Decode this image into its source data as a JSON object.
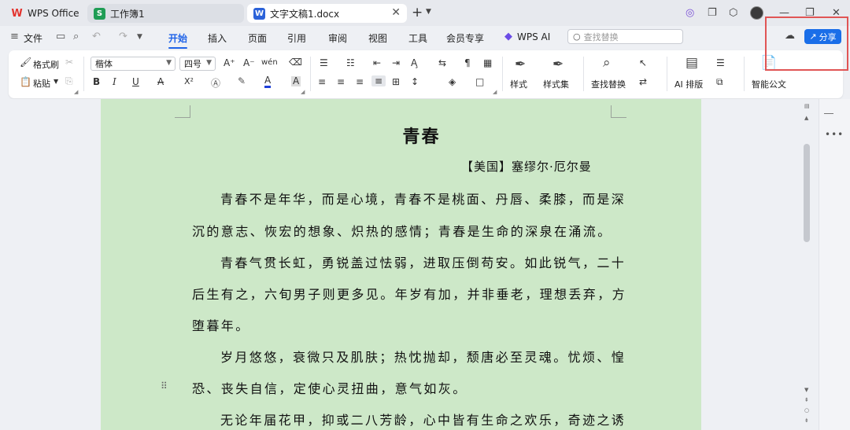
{
  "tabs": [
    {
      "label": "WPS Office",
      "logo": "W"
    },
    {
      "label": "工作簿1",
      "logo": "S"
    },
    {
      "label": "文字文稿1.docx",
      "logo": "W"
    }
  ],
  "menu": {
    "file": "文件",
    "items": [
      "开始",
      "插入",
      "页面",
      "引用",
      "审阅",
      "视图",
      "工具",
      "会员专享",
      "WPS AI"
    ],
    "active": "开始",
    "search_placeholder": "查找替换",
    "share": "分享"
  },
  "ribbon": {
    "format_painter": "格式刷",
    "paste": "粘贴",
    "font_name": "楷体",
    "font_size": "四号",
    "style": "样式",
    "style_set": "样式集",
    "find_replace": "查找替换",
    "ai_layout": "AI 排版",
    "smart_doc": "智能公文",
    "bold": "B",
    "italic": "I",
    "underline": "U",
    "strike": "A",
    "superscript": "X²",
    "font_color": "A",
    "char_shade": "A",
    "grow": "A⁺",
    "shrink": "A⁻",
    "phonetic": "wén",
    "clear_format": "⌫"
  },
  "colors": {
    "accent": "#1f63e8",
    "share_bg": "#1a6ee8",
    "page_bg": "#cde8c8",
    "highlight_box": "#e05555"
  },
  "document": {
    "title": "青春",
    "author": "【美国】塞缪尔·厄尔曼",
    "lines": [
      "青春不是年华，而是心境，青春不是桃面、丹唇、柔膝，而是深",
      "沉的意志、恢宏的想象、炽热的感情；青春是生命的深泉在涌流。",
      "青春气贯长虹，勇锐盖过怯弱，进取压倒苟安。如此锐气，二十",
      "后生有之，六旬男子则更多见。年岁有加，并非垂老，理想丢弃，方",
      "堕暮年。",
      "岁月悠悠，衰微只及肌肤；热忱抛却，颓唐必至灵魂。忧烦、惶",
      "恐、丧失自信，定使心灵扭曲，意气如灰。",
      "无论年届花甲，抑或二八芳龄，心中皆有生命之欢乐，奇迹之诱"
    ]
  }
}
